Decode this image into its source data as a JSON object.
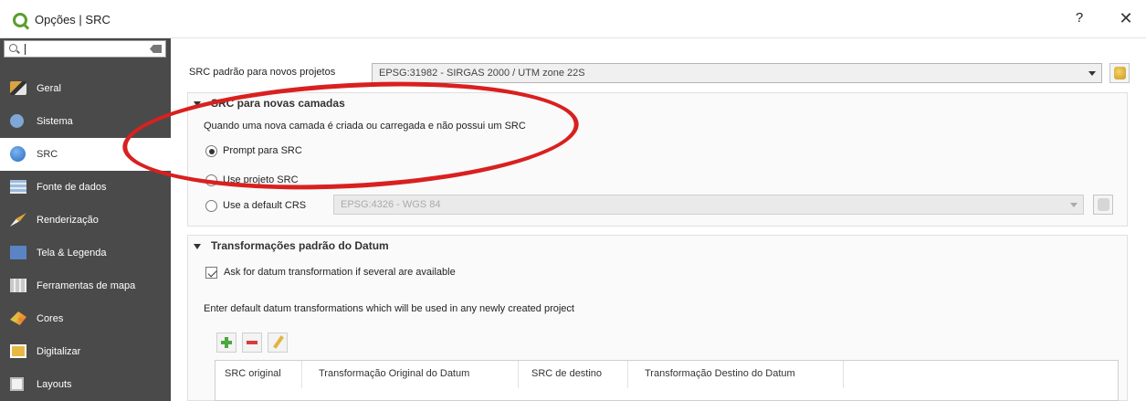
{
  "window": {
    "title": "Opções | SRC",
    "help_label": "?",
    "close_label": "✕"
  },
  "sidebar": {
    "items": [
      {
        "label": "Geral",
        "icon": "general-icon"
      },
      {
        "label": "Sistema",
        "icon": "system-icon"
      },
      {
        "label": "SRC",
        "icon": "globe-icon",
        "active": true
      },
      {
        "label": "Fonte de dados",
        "icon": "data-source-icon"
      },
      {
        "label": "Renderização",
        "icon": "rendering-icon"
      },
      {
        "label": "Tela & Legenda",
        "icon": "canvas-legend-icon"
      },
      {
        "label": "Ferramentas de mapa",
        "icon": "map-tools-icon"
      },
      {
        "label": "Cores",
        "icon": "colors-icon"
      },
      {
        "label": "Digitalizar",
        "icon": "digitizing-icon"
      },
      {
        "label": "Layouts",
        "icon": "layouts-icon"
      }
    ]
  },
  "default_crs": {
    "label": "SRC padrão para novos projetos",
    "value": "EPSG:31982 - SIRGAS 2000 / UTM zone 22S"
  },
  "new_layers_group": {
    "title": "SRC para novas camadas",
    "description": "Quando uma nova camada é criada ou carregada e não possui um SRC",
    "options": [
      {
        "label": "Prompt para SRC",
        "checked": true
      },
      {
        "label": "Use projeto SRC",
        "checked": false
      },
      {
        "label": "Use a default CRS",
        "checked": false
      }
    ],
    "default_crs_value": "EPSG:4326 - WGS 84"
  },
  "datum_group": {
    "title": "Transformações padrão do Datum",
    "ask_checkbox_label": "Ask for datum transformation if several are available",
    "ask_checked": true,
    "description": "Enter default datum transformations which will be used in any newly created project",
    "table_columns": [
      "SRC original",
      "Transformação Original do Datum",
      "SRC de destino",
      "Transformação Destino do Datum"
    ]
  },
  "colors": {
    "sidebar_bg": "#4a4a4a",
    "annotation": "#d92020",
    "accent_green": "#49a83f"
  }
}
